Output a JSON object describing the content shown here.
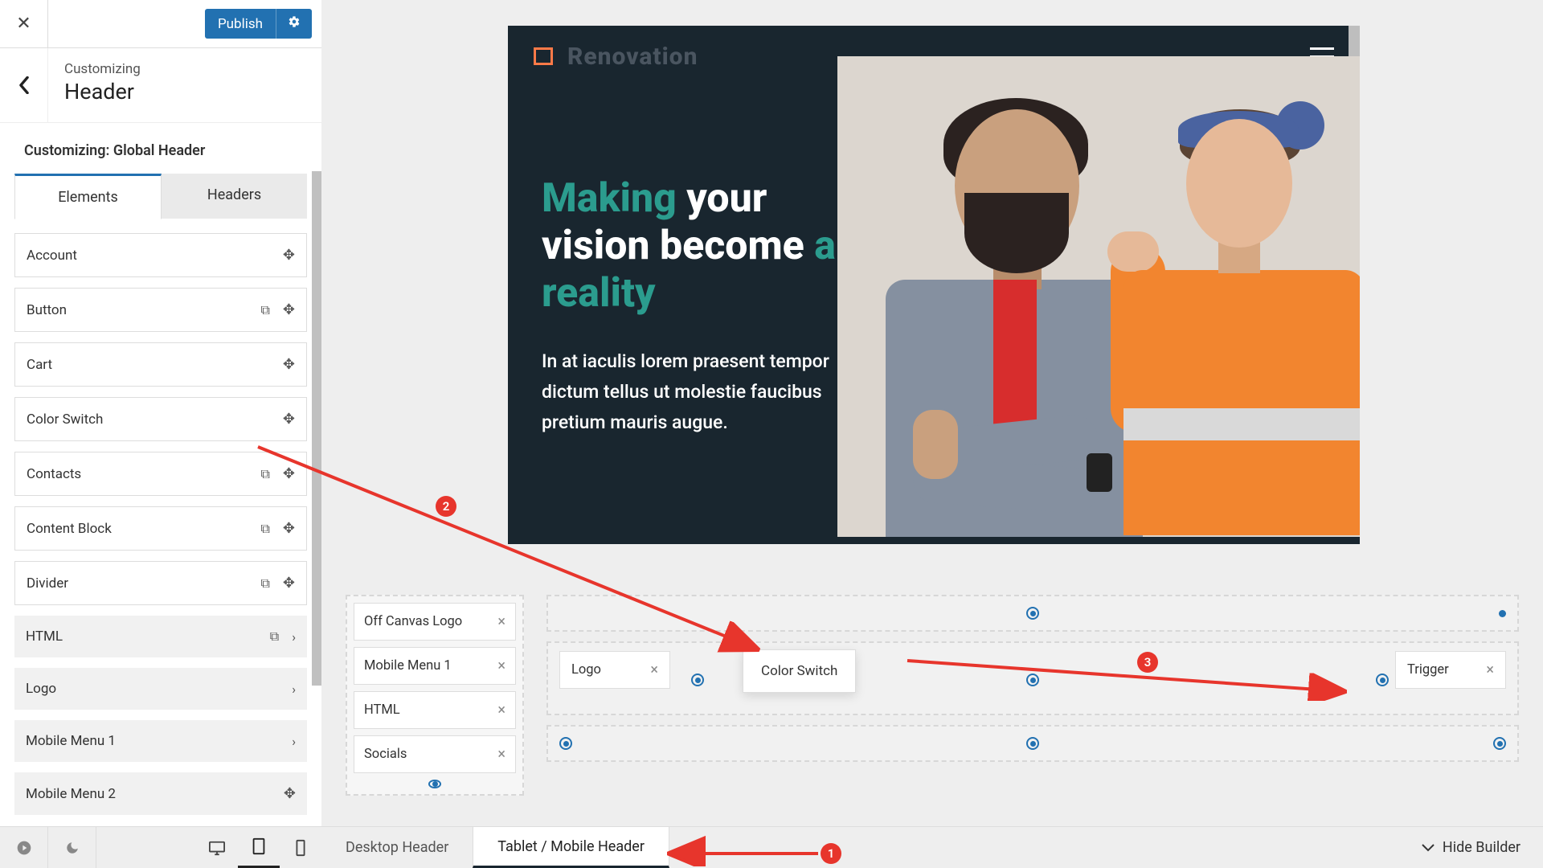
{
  "top": {
    "publish": "Publish"
  },
  "header": {
    "sup": "Customizing",
    "title": "Header"
  },
  "subtitle": "Customizing: Global Header",
  "tabs": {
    "elements": "Elements",
    "headers": "Headers"
  },
  "elements": {
    "account": "Account",
    "button": "Button",
    "cart": "Cart",
    "color_switch": "Color Switch",
    "contacts": "Contacts",
    "content_block": "Content Block",
    "divider": "Divider",
    "html": "HTML",
    "logo": "Logo",
    "mobile_menu_1": "Mobile Menu 1",
    "mobile_menu_2": "Mobile Menu 2"
  },
  "preview": {
    "brand": "Renovation",
    "h1_a": "Making",
    "h1_b": "your vision",
    "h1_c": "become",
    "h1_d": "a reality",
    "para": "In at iaculis lorem praesent tempor dictum tellus ut molestie faucibus pretium mauris augue."
  },
  "builder": {
    "off_canvas": {
      "logo": "Off Canvas Logo",
      "mm1": "Mobile Menu 1",
      "html": "HTML",
      "socials": "Socials"
    },
    "logo": "Logo",
    "trigger": "Trigger",
    "float_cs": "Color Switch"
  },
  "bottom_tabs": {
    "desktop": "Desktop Header",
    "mobile": "Tablet / Mobile Header",
    "hide": "Hide Builder"
  },
  "anno": {
    "n1": "1",
    "n2": "2",
    "n3": "3"
  }
}
